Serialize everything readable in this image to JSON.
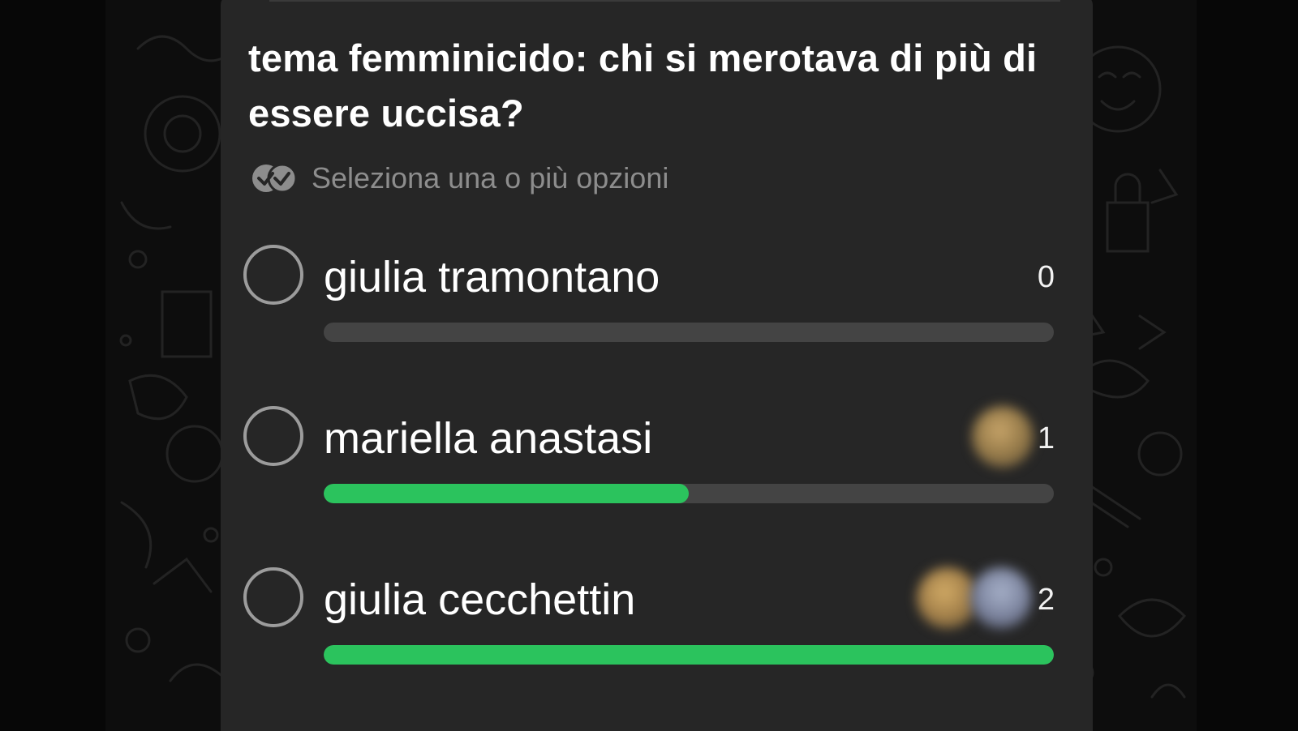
{
  "poll": {
    "question": "tema femminicido: chi si merotava di più di essere uccisa?",
    "hint": "Seleziona una o più opzioni",
    "hint_icon": "double-check-icon",
    "accent_color": "#2bc35d",
    "options": [
      {
        "label": "giulia tramontano",
        "votes": "0",
        "fill_fraction": 0.0,
        "voter_avatars": 0
      },
      {
        "label": "mariella anastasi",
        "votes": "1",
        "fill_fraction": 0.5,
        "voter_avatars": 1
      },
      {
        "label": "giulia cecchettin",
        "votes": "2",
        "fill_fraction": 1.0,
        "voter_avatars": 2
      }
    ]
  }
}
